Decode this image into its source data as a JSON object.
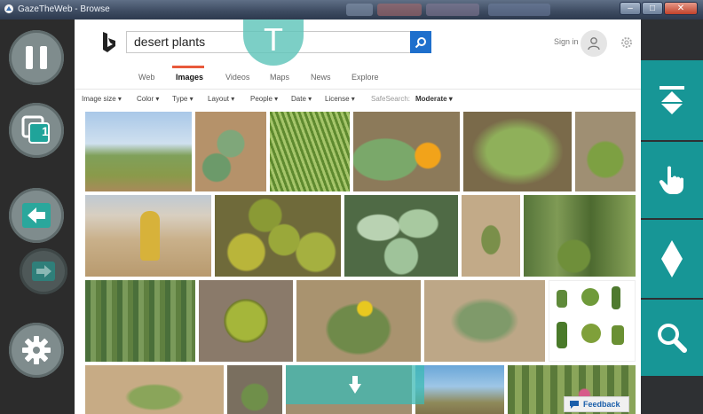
{
  "window": {
    "title": "GazeTheWeb - Browse",
    "controls": [
      "minimize",
      "maximize",
      "close"
    ]
  },
  "left_panel": {
    "buttons": [
      {
        "name": "pause",
        "icon": "pause-icon"
      },
      {
        "name": "tabs",
        "icon": "tab-counter-icon",
        "tab_count": "1"
      },
      {
        "name": "back",
        "icon": "arrow-left-icon"
      },
      {
        "name": "forward",
        "icon": "arrow-right-icon"
      },
      {
        "name": "settings",
        "icon": "gear-icon"
      }
    ]
  },
  "right_panel": {
    "buttons": [
      {
        "name": "scroll-to-top",
        "icon": "scroll-top-icon"
      },
      {
        "name": "click",
        "icon": "hand-pointer-icon"
      },
      {
        "name": "pivot",
        "icon": "diamond-icon"
      },
      {
        "name": "zoom",
        "icon": "magnifier-icon"
      }
    ],
    "accent_color": "#179696"
  },
  "search": {
    "query": "desert plants",
    "sign_in": "Sign in"
  },
  "tabs": [
    {
      "label": "Web"
    },
    {
      "label": "Images",
      "active": true
    },
    {
      "label": "Videos"
    },
    {
      "label": "Maps"
    },
    {
      "label": "News"
    },
    {
      "label": "Explore"
    }
  ],
  "filters": {
    "image_size": "Image size",
    "color": "Color",
    "type": "Type",
    "layout": "Layout",
    "people": "People",
    "date": "Date",
    "license": "License",
    "safesearch_label": "SafeSearch:",
    "safesearch_value": "Moderate"
  },
  "overlay": {
    "text_input_key": "T"
  },
  "feedback": {
    "label": "Feedback"
  },
  "colors": {
    "accent_tab": "#e8593b",
    "search_button": "#1e6fcc",
    "overlay": "#5fc4ba"
  }
}
